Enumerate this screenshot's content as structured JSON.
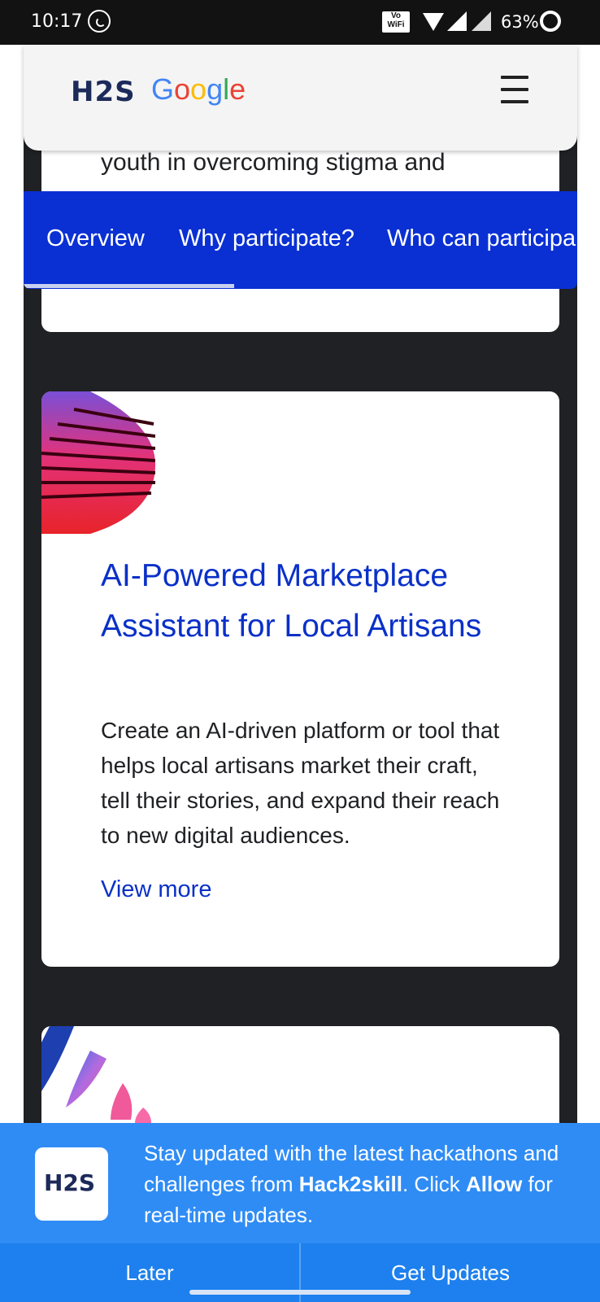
{
  "status_bar": {
    "time": "10:17",
    "volte": "Vo WiFi",
    "battery": "63%"
  },
  "header": {
    "logo_h2s": "H2S",
    "logo_google": [
      "G",
      "o",
      "o",
      "g",
      "l",
      "e"
    ],
    "menu_icon": "hamburger-menu-icon"
  },
  "top_card": {
    "text": "youth in overcoming stigma and"
  },
  "tabs": [
    {
      "label": "Overview"
    },
    {
      "label": "Why participate?"
    },
    {
      "label": "Who can participa"
    }
  ],
  "cards": [
    {
      "title": "AI-Powered Marketplace Assistant for Local Artisans",
      "description": "Create an AI-driven platform or tool that helps local artisans market their craft, tell their stories, and expand their reach to new digital audiences.",
      "link": "View more"
    }
  ],
  "notification": {
    "logo": "H2S",
    "text_part1": "Stay updated with the latest hackathons and challenges from ",
    "brand": "Hack2skill",
    "text_part2": ". Click ",
    "allow": "Allow",
    "text_part3": " for real-time updates.",
    "later_label": "Later",
    "get_updates_label": "Get Updates"
  },
  "colors": {
    "primary": "#0a30d4",
    "link": "#0a30c8",
    "banner": "#2f8cf5"
  }
}
